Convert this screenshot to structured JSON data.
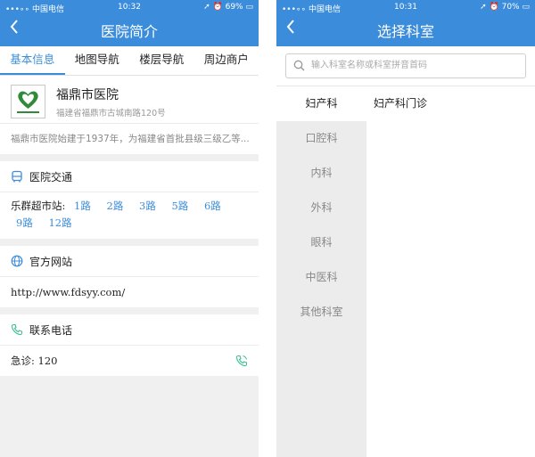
{
  "colors": {
    "accent": "#3b8ddb",
    "call_green": "#3fbf8f",
    "bg": "#f0f0f0"
  },
  "left": {
    "status": {
      "carrier": "•••∘∘ 中国电信",
      "time": "10:32",
      "battery": "69%"
    },
    "nav": {
      "back_icon": "chevron-left-icon",
      "title": "医院简介"
    },
    "tabs": [
      "基本信息",
      "地图导航",
      "楼层导航",
      "周边商户"
    ],
    "hospital": {
      "name": "福鼎市医院",
      "address": "福建省福鼎市古城南路120号",
      "intro": "福鼎市医院始建于1937年，为福建省首批县级三级乙等..."
    },
    "traffic": {
      "title": "医院交通",
      "icon": "bus-icon",
      "stop": "乐群超市站:",
      "routes": [
        "1路",
        "2路",
        "3路",
        "5路",
        "6路",
        "9路",
        "12路"
      ]
    },
    "website": {
      "title": "官方网站",
      "icon": "globe-icon",
      "url": "http://www.fdsyy.com/"
    },
    "contact": {
      "title": "联系电话",
      "icon": "phone-icon",
      "line": "急诊:  120"
    }
  },
  "right": {
    "status": {
      "carrier": "•••∘∘ 中国电信",
      "time": "10:31",
      "battery": "70%"
    },
    "nav": {
      "back_icon": "chevron-left-icon",
      "title": "选择科室"
    },
    "search": {
      "placeholder": "输入科室名称或科室拼音首码",
      "value": ""
    },
    "departments": [
      "妇产科",
      "口腔科",
      "内科",
      "外科",
      "眼科",
      "中医科",
      "其他科室"
    ],
    "sub_departments": [
      "妇产科门诊"
    ]
  }
}
